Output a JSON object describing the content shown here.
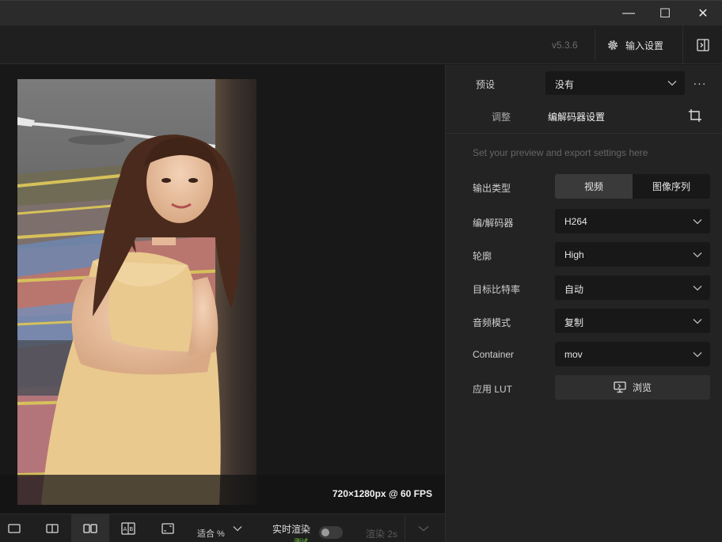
{
  "window": {
    "minimize_glyph": "—",
    "maximize_glyph": "☐",
    "close_glyph": "✕"
  },
  "header": {
    "version": "v5.3.6",
    "input_settings_label": "输入设置",
    "input_settings_icon": "gear-icon",
    "panel_toggle_icon": "panel-toggle-icon"
  },
  "preview": {
    "resolution_text": "720×1280px @ 60 FPS"
  },
  "toolbar": {
    "fit_label": "适合 %",
    "live_render_label": "实时渲染",
    "test_label": "测试",
    "render_label": "渲染 2s",
    "live_render_on": false,
    "accent_color": "#6fcf3f"
  },
  "panel": {
    "preset_label": "预设",
    "preset_value": "没有",
    "more_glyph": "···",
    "tab_adjust": "调整",
    "tab_codec": "编解码器设置",
    "hint": "Set your preview and export settings here",
    "output_type_label": "输出类型",
    "output_type_options": [
      "视频",
      "图像序列"
    ],
    "codec_label": "编/解码器",
    "codec_value": "H264",
    "profile_label": "轮廓",
    "profile_value": "High",
    "bitrate_label": "目标比特率",
    "bitrate_value": "自动",
    "audio_label": "音频模式",
    "audio_value": "复制",
    "container_label": "Container",
    "container_value": "mov",
    "lut_label": "应用 LUT",
    "browse_label": "浏览"
  }
}
